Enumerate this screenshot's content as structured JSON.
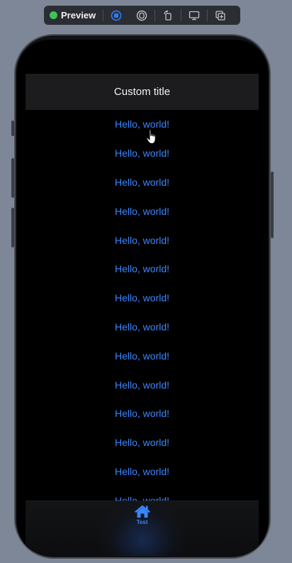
{
  "toolbar": {
    "status_label": "Preview",
    "status_color": "#3fc25a",
    "buttons": [
      "live-icon",
      "selectable-icon",
      "rotate-icon",
      "device-settings-icon",
      "duplicate-icon"
    ]
  },
  "nav": {
    "title": "Custom title"
  },
  "list": {
    "items": [
      "Hello, world!",
      "Hello, world!",
      "Hello, world!",
      "Hello, world!",
      "Hello, world!",
      "Hello, world!",
      "Hello, world!",
      "Hello, world!",
      "Hello, world!",
      "Hello, world!",
      "Hello, world!",
      "Hello, world!",
      "Hello, world!",
      "Hello, world!"
    ],
    "text_color": "#3a86ff"
  },
  "tab_bar": {
    "tabs": [
      {
        "label": "Test",
        "icon": "house-icon",
        "selected": true
      }
    ],
    "accent_color": "#3a86ff"
  }
}
